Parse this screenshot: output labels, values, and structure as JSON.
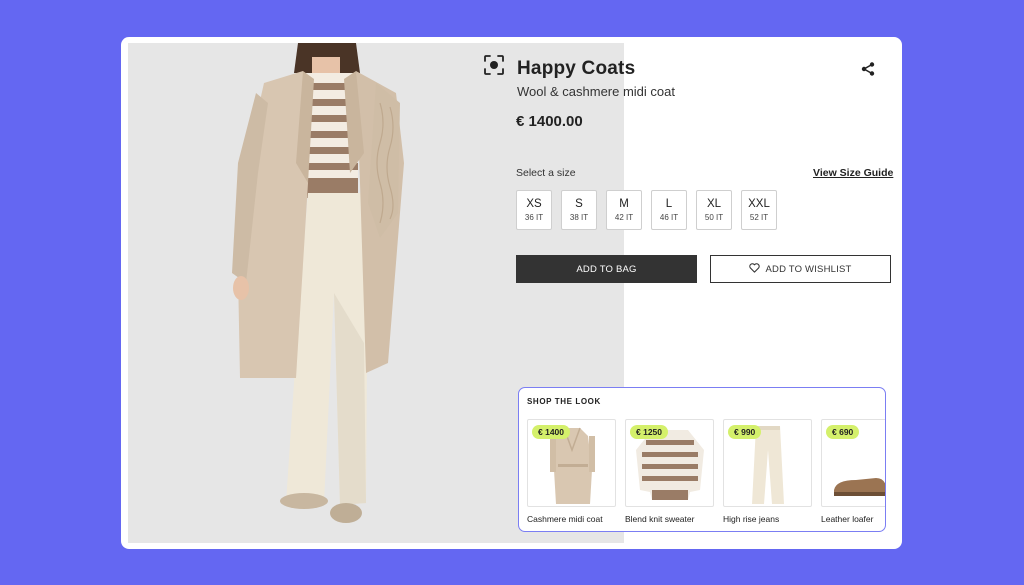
{
  "product": {
    "brand": "Happy Coats",
    "name": "Wool & cashmere midi coat",
    "price": "€ 1400.00"
  },
  "size_selector": {
    "label": "Select a size",
    "guide_link": "View Size Guide",
    "sizes": [
      {
        "size": "XS",
        "it": "36 IT"
      },
      {
        "size": "S",
        "it": "38 IT"
      },
      {
        "size": "M",
        "it": "42 IT"
      },
      {
        "size": "L",
        "it": "46 IT"
      },
      {
        "size": "XL",
        "it": "50 IT"
      },
      {
        "size": "XXL",
        "it": "52 IT"
      }
    ]
  },
  "actions": {
    "add_to_bag": "ADD TO BAG",
    "add_to_wishlist": "ADD TO WISHLIST"
  },
  "shop_the_look": {
    "title": "SHOP THE LOOK",
    "items": [
      {
        "price": "€ 1400",
        "name": "Cashmere midi coat"
      },
      {
        "price": "€ 1250",
        "name": "Blend knit sweater"
      },
      {
        "price": "€ 990",
        "name": "High rise jeans"
      },
      {
        "price": "€ 690",
        "name": "Leather loafer"
      }
    ]
  },
  "icons": {
    "scan": "scan-icon",
    "share": "share-icon",
    "heart": "heart-icon"
  },
  "colors": {
    "background": "#6467f2",
    "primary_button": "#333333",
    "price_badge": "#d4f06b",
    "look_border": "#7b7ef3"
  }
}
